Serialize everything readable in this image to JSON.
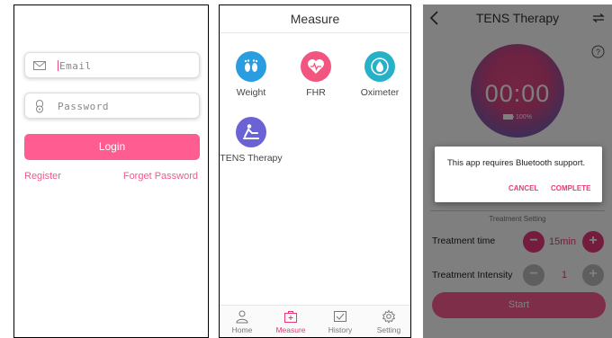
{
  "login": {
    "email_placeholder": "Email",
    "password_placeholder": "Password",
    "login_label": "Login",
    "register_label": "Register",
    "forget_label": "Forget Password",
    "accent": "#ff5c92"
  },
  "measure": {
    "title": "Measure",
    "tiles": [
      {
        "label": "Weight",
        "icon": "footprints-icon",
        "color": "#2a9de0"
      },
      {
        "label": "FHR",
        "icon": "heart-icon",
        "color": "#f2557f"
      },
      {
        "label": "Oximeter",
        "icon": "oximeter-drop-icon",
        "color": "#27b1c8"
      },
      {
        "label": "TENS Therapy",
        "icon": "tens-therapy-icon",
        "color": "#6b62d6"
      }
    ],
    "nav": [
      {
        "label": "Home",
        "icon": "person-icon"
      },
      {
        "label": "Measure",
        "icon": "medkit-icon",
        "active": true
      },
      {
        "label": "History",
        "icon": "history-icon"
      },
      {
        "label": "Setting",
        "icon": "gear-icon"
      }
    ]
  },
  "tens": {
    "title": "TENS Therapy",
    "timer": "00:00",
    "battery": "100%",
    "section_title": "Treatment Setting",
    "time_label": "Treatment time",
    "time_value": "15min",
    "intensity_label": "Treatment Intensity",
    "intensity_value": "1",
    "start_label": "Start",
    "dialog": {
      "message": "This app requires Bluetooth support.",
      "cancel": "CANCEL",
      "complete": "COMPLETE"
    }
  }
}
